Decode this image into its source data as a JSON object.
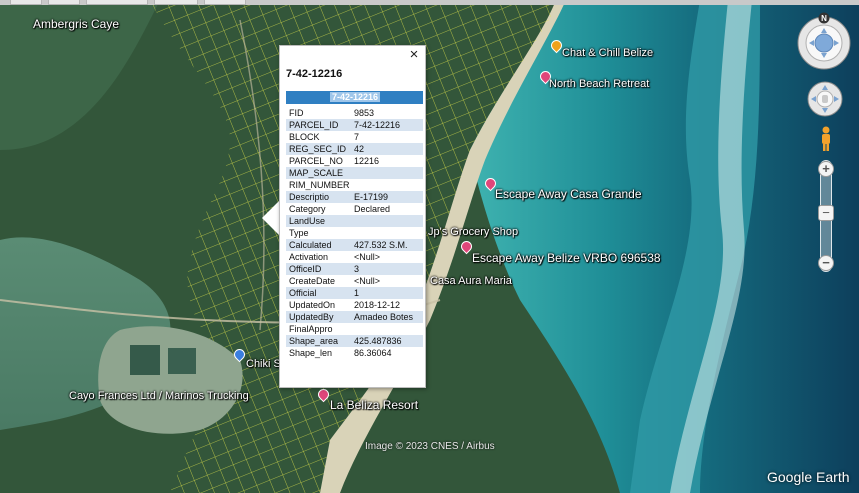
{
  "places": {
    "ambergris": "Ambergris Caye",
    "chat_chill": "Chat & Chill Belize",
    "north_beach": "North Beach Retreat",
    "escape_grande": "Escape Away Casa Grande",
    "grocery": "Jp's Grocery Shop",
    "escape_vrbo": "Escape Away Belize VRBO 696538",
    "casa_aura": "Casa Aura Maria",
    "chiki": "Chiki S",
    "cayo": "Cayo Frances Ltd / Marinos Trucking",
    "beliza": "La Beliza Resort"
  },
  "attribution": "Image © 2023 CNES / Airbus",
  "brand": "Google Earth",
  "balloon": {
    "title": "7-42-12216",
    "table_header": "7-42-12216",
    "close_glyph": "×",
    "rows": [
      {
        "key": "FID",
        "value": "9853"
      },
      {
        "key": "PARCEL_ID",
        "value": "7-42-12216"
      },
      {
        "key": "BLOCK",
        "value": "7"
      },
      {
        "key": "REG_SEC_ID",
        "value": "42"
      },
      {
        "key": "PARCEL_NO",
        "value": "12216"
      },
      {
        "key": "MAP_SCALE",
        "value": ""
      },
      {
        "key": "RIM_NUMBER",
        "value": ""
      },
      {
        "key": "Descriptio",
        "value": "E-17199"
      },
      {
        "key": "Category",
        "value": "Declared"
      },
      {
        "key": "LandUse",
        "value": ""
      },
      {
        "key": "Type",
        "value": ""
      },
      {
        "key": "Calculated",
        "value": "427.532 S.M."
      },
      {
        "key": "Activation",
        "value": "<Null>"
      },
      {
        "key": "OfficeID",
        "value": "3"
      },
      {
        "key": "CreateDate",
        "value": "<Null>"
      },
      {
        "key": "Official",
        "value": "1"
      },
      {
        "key": "UpdatedOn",
        "value": "2018-12-12"
      },
      {
        "key": "UpdatedBy",
        "value": "Amadeo Botes"
      },
      {
        "key": "FinalAppro",
        "value": ""
      },
      {
        "key": "Shape_area",
        "value": "425.487836"
      },
      {
        "key": "Shape_len",
        "value": "86.36064"
      }
    ]
  },
  "controls": {
    "compass_north": "N",
    "zoom_in": "+",
    "zoom_out": "−",
    "zoom_handle": "−"
  },
  "icons": {
    "close": "close-icon",
    "compass": "compass-icon",
    "pan": "pan-icon",
    "pegman": "pegman-icon"
  }
}
